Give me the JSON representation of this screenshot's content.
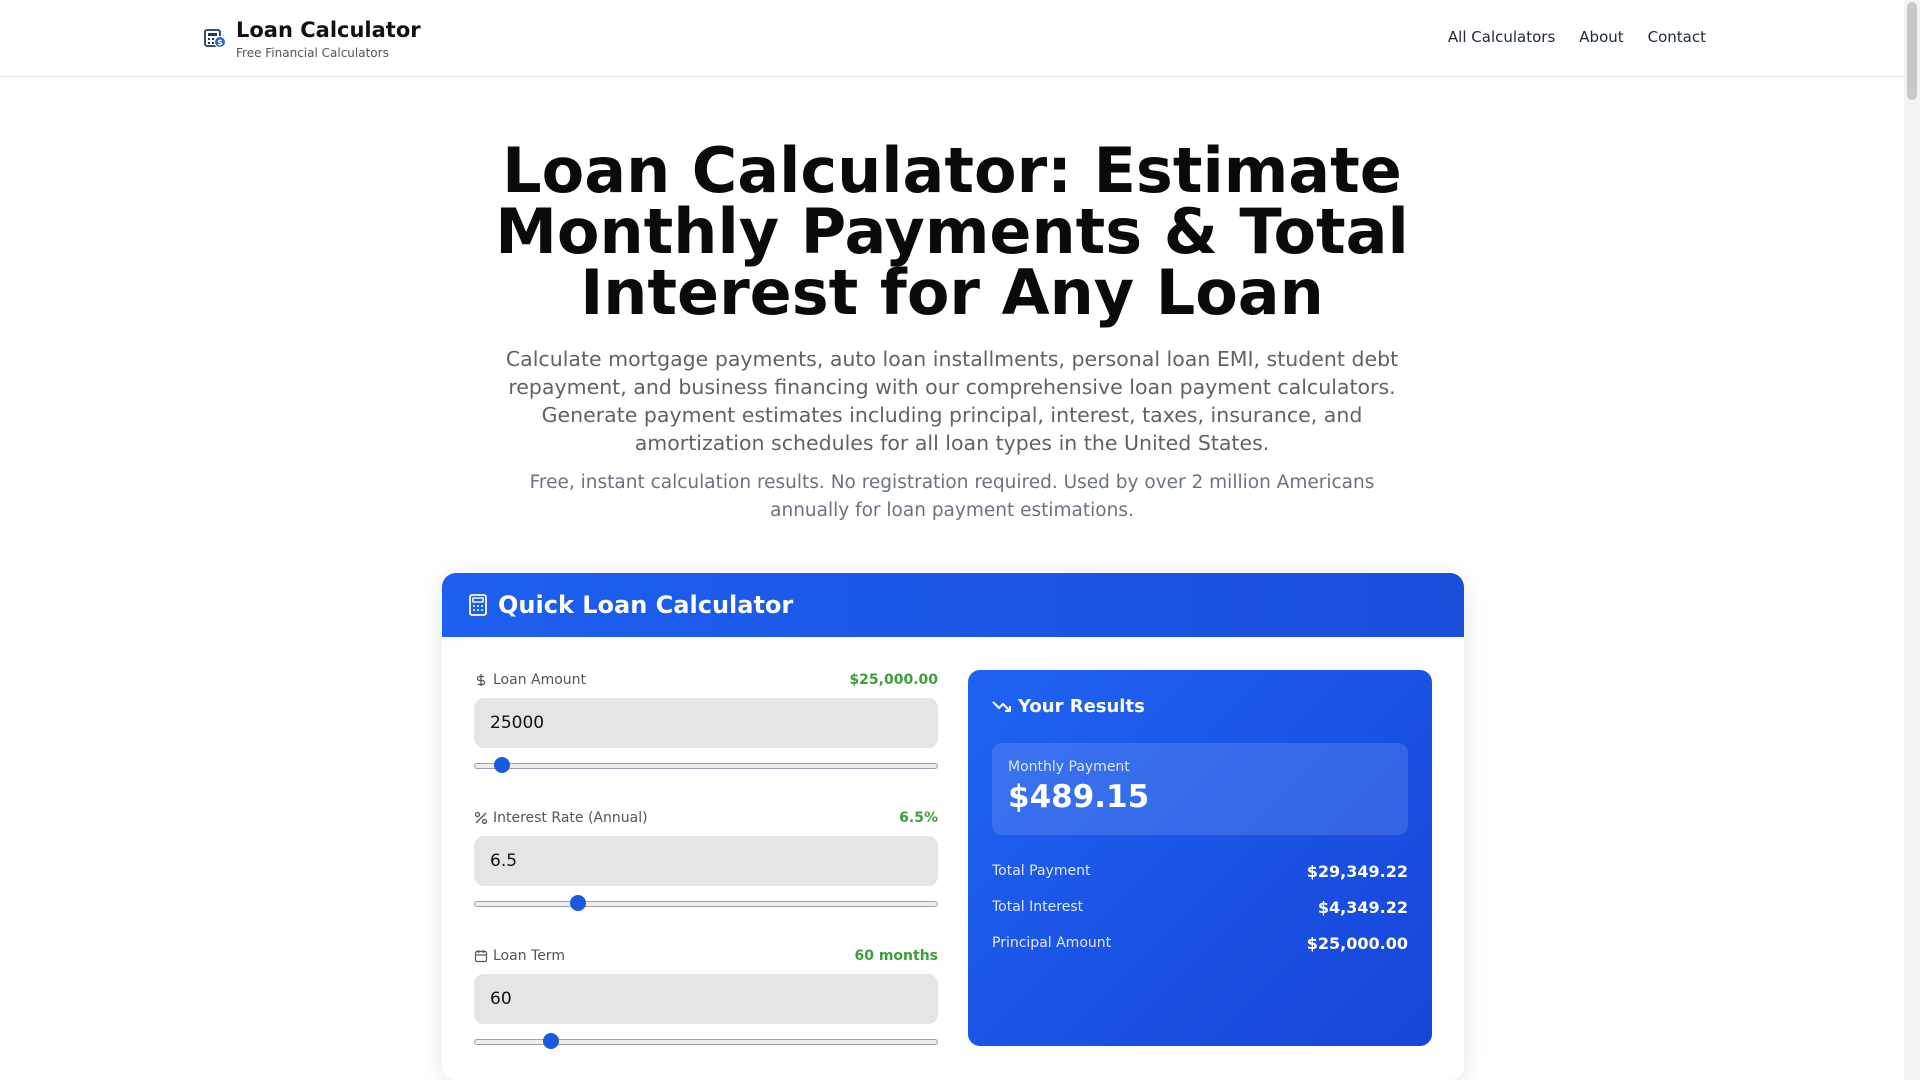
{
  "header": {
    "brand_title": "Loan Calculator",
    "brand_subtitle": "Free Financial Calculators",
    "nav": [
      "All Calculators",
      "About",
      "Contact"
    ]
  },
  "hero": {
    "title": "Loan Calculator: Estimate Monthly Payments & Total Interest for Any Loan",
    "description": "Calculate mortgage payments, auto loan installments, personal loan EMI, student debt repayment, and business financing with our comprehensive loan payment calculators. Generate payment estimates including principal, interest, taxes, insurance, and amortization schedules for all loan types in the United States.",
    "note": "Free, instant calculation results. No registration required. Used by over 2 million Americans annually for loan payment estimations."
  },
  "calculator": {
    "title": "Quick Loan Calculator",
    "fields": [
      {
        "label": "Loan Amount",
        "display": "$25,000.00",
        "input": "25000",
        "slider_fraction": 0.06,
        "icon": "dollar-icon"
      },
      {
        "label": "Interest Rate (Annual)",
        "display": "6.5%",
        "input": "6.5",
        "slider_fraction": 0.225,
        "icon": "percent-icon"
      },
      {
        "label": "Loan Term",
        "display": "60 months",
        "input": "60",
        "slider_fraction": 0.165,
        "icon": "calendar-icon"
      }
    ]
  },
  "results": {
    "title": "Your Results",
    "monthly_label": "Monthly Payment",
    "monthly_value": "$489.15",
    "rows": [
      {
        "label": "Total Payment",
        "value": "$29,349.22"
      },
      {
        "label": "Total Interest",
        "value": "$4,349.22"
      },
      {
        "label": "Principal Amount",
        "value": "$25,000.00"
      }
    ]
  },
  "colors": {
    "accent": "#1a5ae0",
    "value_green": "#3aa13a"
  }
}
